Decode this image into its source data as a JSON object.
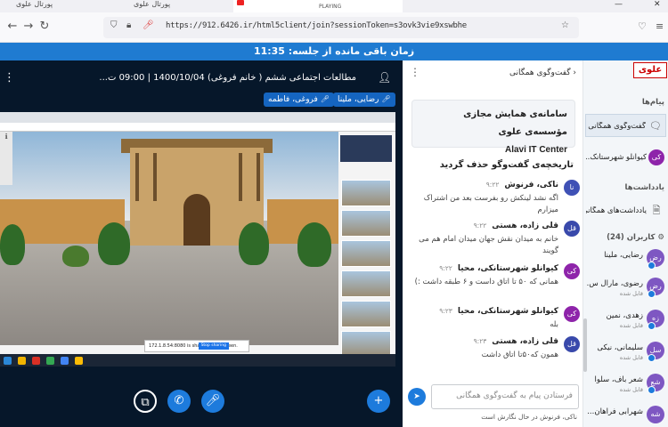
{
  "browser": {
    "tabs": [
      {
        "label": "پورتال علوی"
      },
      {
        "label": "پورتال علوی"
      },
      {
        "label": "PLAYING"
      }
    ],
    "url": "https://912.6426.ir/html5client/join?sessionToken=s3ovk3vie9xswbhe",
    "window_controls": {
      "minimize": "—",
      "close": "✕"
    }
  },
  "session": {
    "time_remaining": "زمان باقی مانده از جلسه: 11:35"
  },
  "presentation": {
    "title": "مطالعات اجتماعی ششم ( خانم فروغی) 1400/10/04 | 09:00 ت...",
    "talkers": [
      "رضایی، ملینا",
      "فروغی، فاطمه"
    ],
    "share_notice": "172.1.8.54:8080 is sharing your screen.",
    "share_stop": "Stop sharing",
    "share_side": "ℹ"
  },
  "chat": {
    "title": "گفت‌وگوی همگانی",
    "welcome_line1": "سامانه‌ی همایش مجازی مؤسسه‌ی علوی",
    "welcome_line2": "Alavi IT Center",
    "cleared": "تاریخچه‌ی گفت‌وگو حذف گردید",
    "messages": [
      {
        "avatar": "نا",
        "name": "ناکی، فرنوش",
        "time": "۹:۲۲",
        "body": "اگه نشد لینکش رو بفرست بعد من اشتراک میزارم",
        "color": "#3f51b5"
      },
      {
        "avatar": "قل",
        "name": "قلی زاده، هستی",
        "time": "۹:۲۲",
        "body": "خانم به میدان نقش جهان میدان امام هم می گویند",
        "color": "#3949ab"
      },
      {
        "avatar": "کی",
        "name": "کیوانلو شهرستانکی، محیا",
        "time": "۹:۲۲",
        "body": "همانی که ۵۰ تا اتاق داست و ۶ طبقه داشت :)",
        "color": "#8e24aa"
      },
      {
        "avatar": "کی",
        "name": "کیوانلو شهرستانکی، محیا",
        "time": "۹:۲۳",
        "body": "بله",
        "color": "#8e24aa"
      },
      {
        "avatar": "قل",
        "name": "قلی زاده، هستی",
        "time": "۹:۲۳",
        "body": "همون که۵۰تا اتاق داشت",
        "color": "#3949ab"
      }
    ],
    "input_placeholder": "فرستادن پیام به گفت‌وگوی همگانی",
    "typing": "ناکی، فرنوش در حال نگارش است"
  },
  "userlist": {
    "logo": "علوی",
    "messages_header": "پیام‌ها",
    "public_chat": "گفت‌وگوی همگانی",
    "private_chat_avatar": "کی",
    "private_chat": "کیوانلو شهرستانک...",
    "notes_header": "یادداشت‌ها",
    "shared_notes": "یادداشت‌های همگانی",
    "users_header": "کاربران (24)",
    "users": [
      {
        "avatar": "رض",
        "name": "رضایی، ملینا",
        "sub": ""
      },
      {
        "avatar": "رض",
        "name": "رضوی، مارال س...",
        "sub": "قابل شده"
      },
      {
        "avatar": "زه",
        "name": "زهدی، نمین",
        "sub": "قابل شده"
      },
      {
        "avatar": "سل",
        "name": "سلیمانی، نیکی",
        "sub": "قابل شده"
      },
      {
        "avatar": "شع",
        "name": "شعر باف، سلوا",
        "sub": "قابل شده"
      },
      {
        "avatar": "شه",
        "name": "شهرابی فراهان...",
        "sub": ""
      }
    ]
  },
  "colors": {
    "accent": "#1d7bdc",
    "timebar": "#1f7bd1",
    "presentation_bg": "#06172a"
  }
}
